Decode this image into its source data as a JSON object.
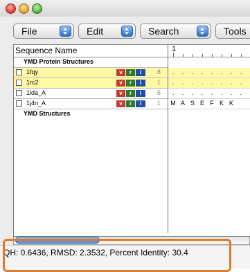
{
  "window": {
    "buttons": [
      "close",
      "minimize",
      "zoom"
    ]
  },
  "menus": [
    {
      "label": "File"
    },
    {
      "label": "Edit"
    },
    {
      "label": "Search"
    },
    {
      "label": "Tools"
    }
  ],
  "table": {
    "left_header": "Sequence Name",
    "ruler_start": "1",
    "groups": [
      {
        "title": "YMD Protein Structures",
        "rows": [
          {
            "name": "1fqy",
            "count": "8",
            "highlighted": true,
            "residues": [
              ".",
              ".",
              ".",
              ".",
              ".",
              ".",
              ".",
              ".",
              "."
            ]
          },
          {
            "name": "1rc2",
            "count": "1",
            "highlighted": true,
            "residues": [
              ".",
              ".",
              ".",
              ".",
              ".",
              ".",
              ".",
              ".",
              "."
            ]
          },
          {
            "name": "1lda_A",
            "count": "6",
            "highlighted": false,
            "residues": [
              ".",
              ".",
              ".",
              ".",
              ".",
              ".",
              ".",
              ".",
              "."
            ]
          },
          {
            "name": "1j4n_A",
            "count": "1",
            "highlighted": false,
            "residues": [
              "M",
              "A",
              "S",
              "E",
              "F",
              "K",
              "K"
            ]
          }
        ]
      },
      {
        "title": "YMD Structures",
        "rows": []
      }
    ],
    "badges": {
      "v": "v",
      "r": "r",
      "i": "i"
    }
  },
  "status_bar": {
    "text": "QH: 0.6436, RMSD: 2.3532, Percent Identity: 30.4"
  },
  "colors": {
    "highlight": "#fff9a6",
    "callout_outline": "#e07a2c",
    "badge_v": "#c43a2e",
    "badge_r": "#2b7a2e",
    "badge_i": "#244ea6"
  }
}
